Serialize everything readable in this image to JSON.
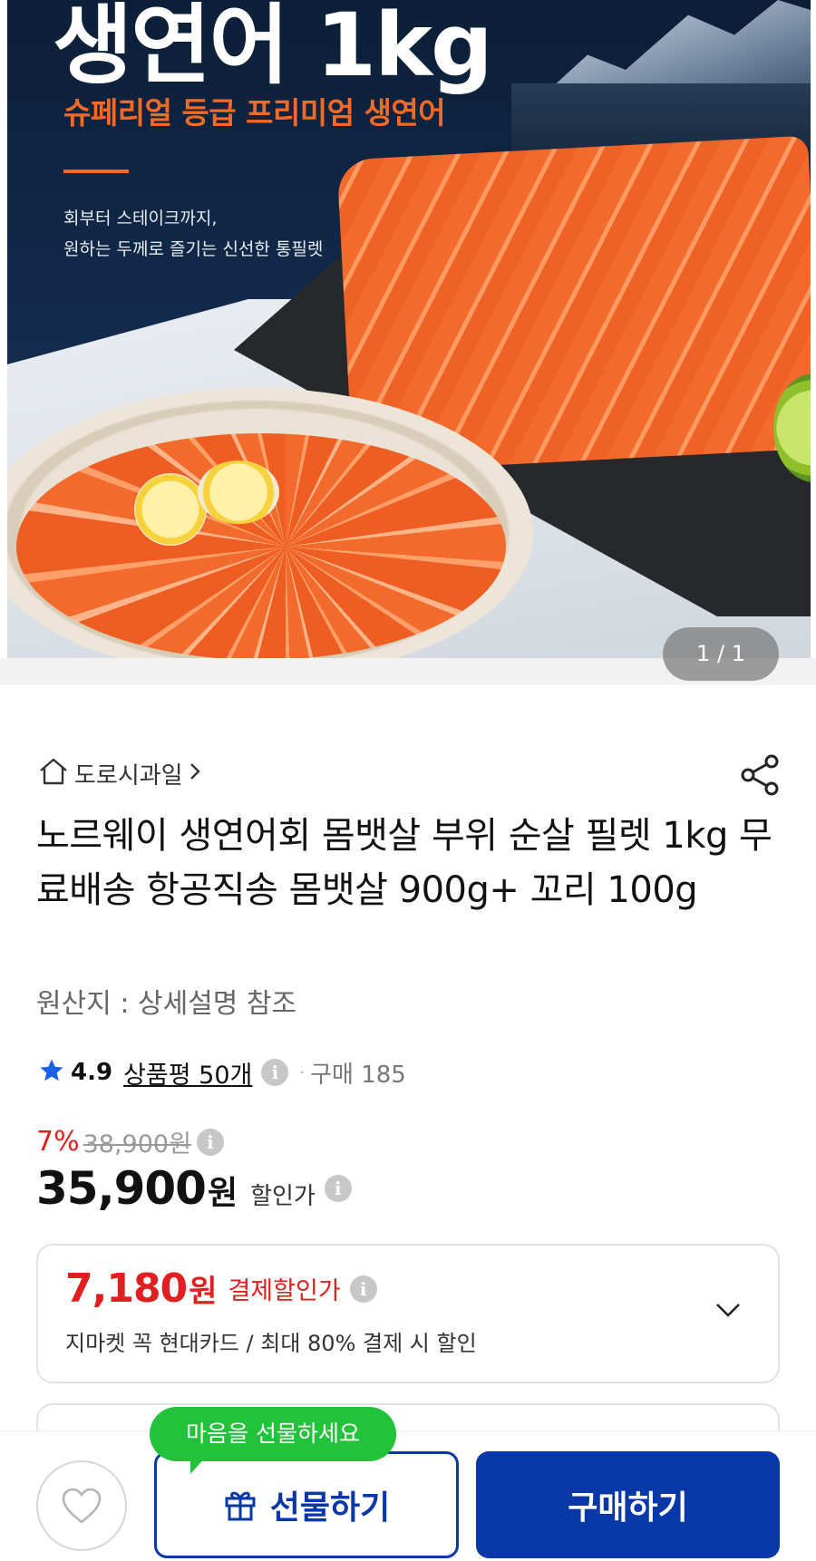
{
  "hero": {
    "title": "생연어 1kg",
    "subtitle": "슈페리얼 등급 프리미엄 생연어",
    "desc_line1": "회부터 스테이크까지,",
    "desc_line2": "원하는 두께로 즐기는 신선한 통필렛",
    "page_counter": "1 / 1"
  },
  "store": {
    "name": "도로시과일",
    "home_icon": "home-icon",
    "share_icon": "share-icon"
  },
  "product": {
    "title": "노르웨이 생연어회 몸뱃살 부위 순살 필렛 1kg 무료배송 항공직송 몸뱃살 900g+ 꼬리 100g",
    "origin": "원산지 : 상세설명 참조"
  },
  "rating": {
    "score": "4.9",
    "reviews": "상품평 50개",
    "separator": "·",
    "purchases": "구매 185"
  },
  "price": {
    "discount_rate": "7%",
    "original": "38,900",
    "original_unit": "원",
    "sale": "35,900",
    "sale_unit": "원",
    "sale_label": "할인가"
  },
  "card_payment": {
    "amount": "7,180",
    "unit": "원",
    "label": "결제할인가",
    "description": "지마켓 꼭 현대카드 / 최대 80% 결제 시 할인"
  },
  "bottom_bar": {
    "gift_bubble": "마음을 선물하세요",
    "gift_label": "선물하기",
    "buy_label": "구매하기"
  },
  "colors": {
    "brand_blue": "#0838a8",
    "discount_red": "#e02020",
    "star_blue": "#1a5fe8",
    "bubble_green": "#22c33a",
    "hero_orange": "#f36a26"
  }
}
